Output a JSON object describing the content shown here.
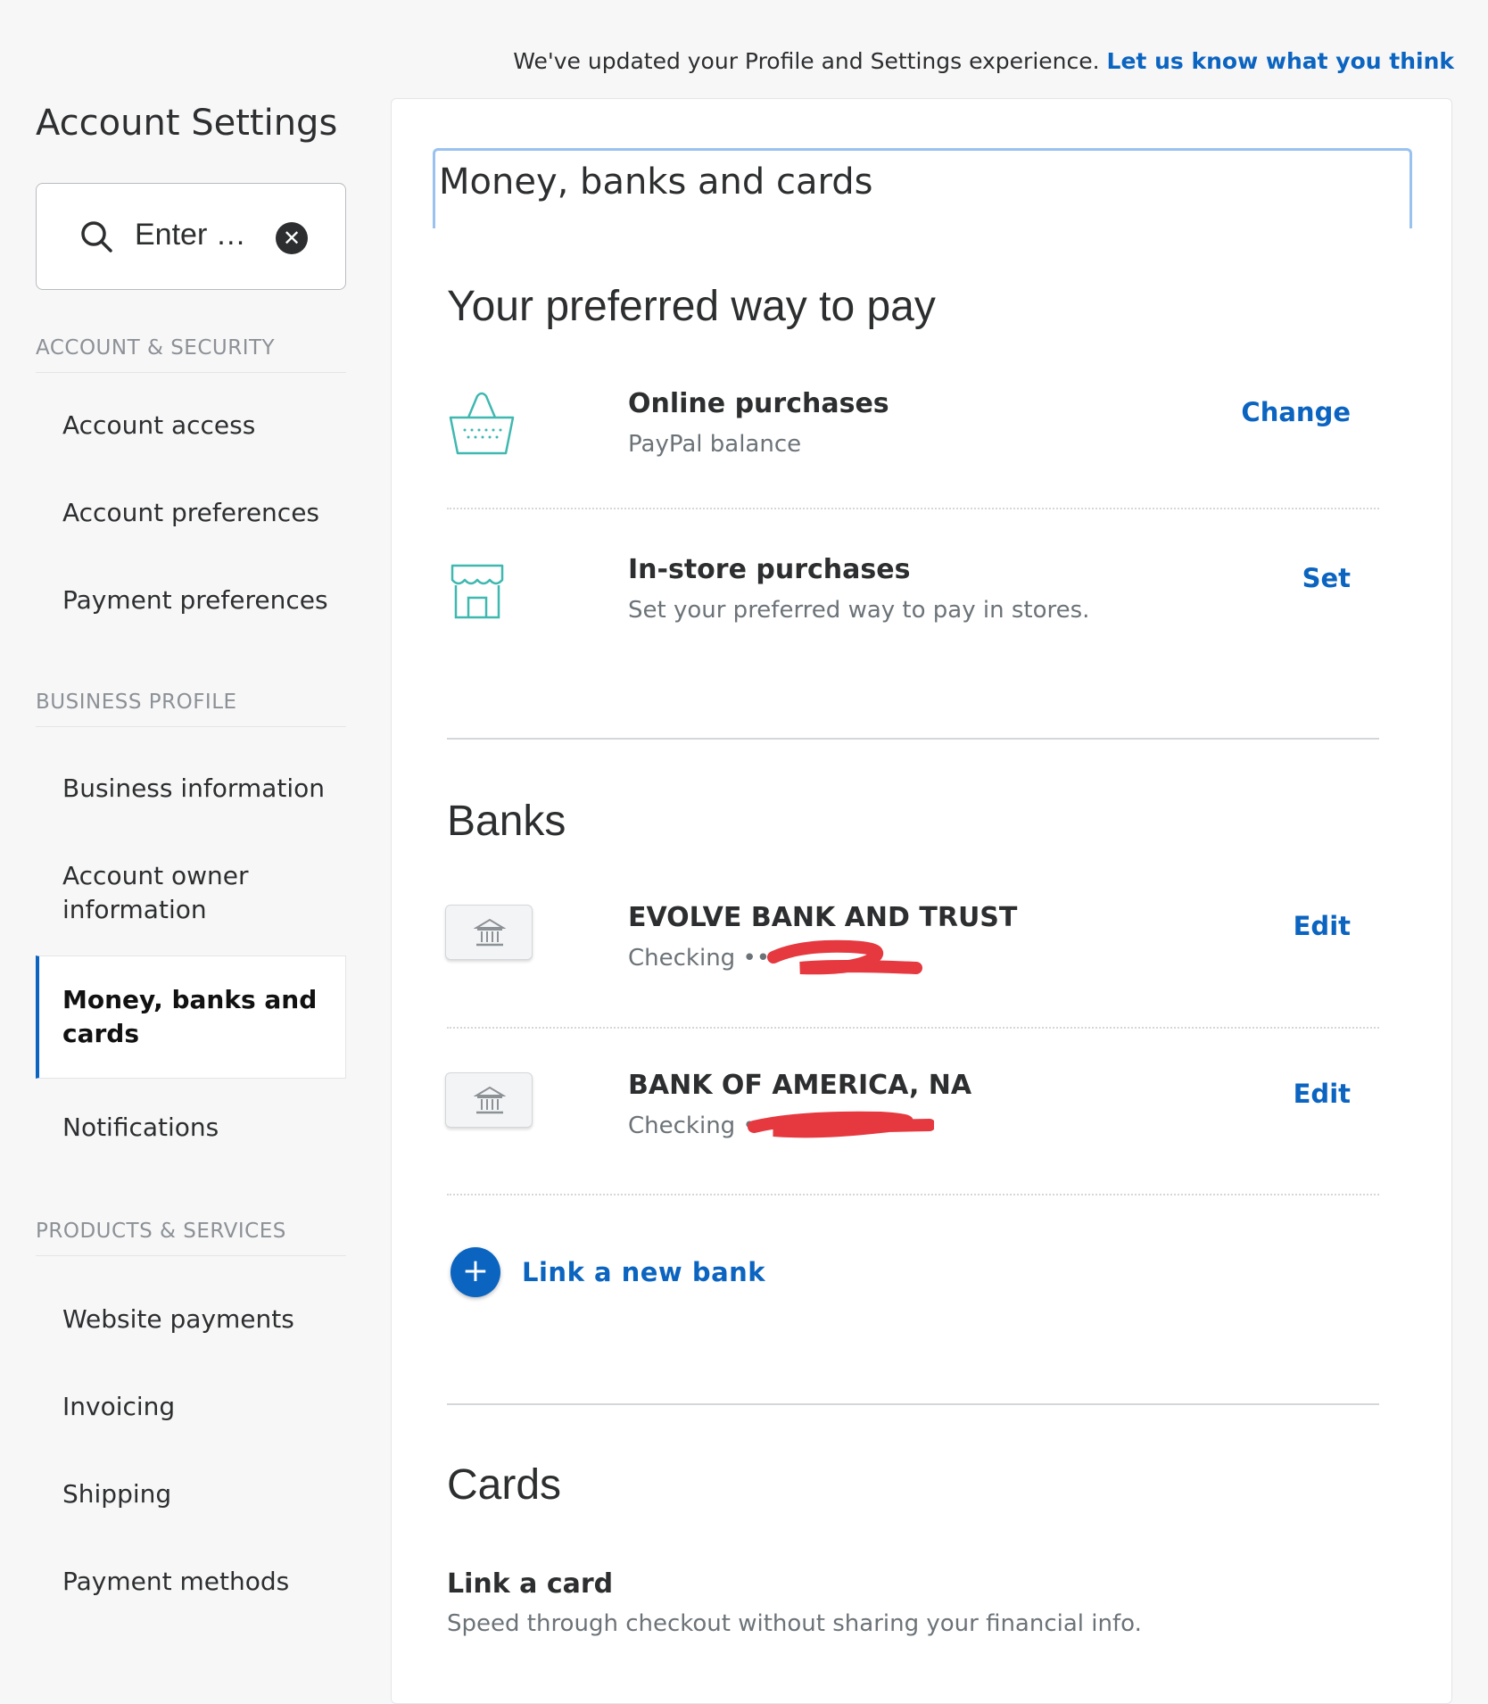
{
  "banner": {
    "text": "We've updated your Profile and Settings experience.",
    "link": "Let us know what you think"
  },
  "sidebar": {
    "title": "Account Settings",
    "search_placeholder": "Enter …",
    "sections": [
      {
        "label": "ACCOUNT & SECURITY",
        "items": [
          "Account access",
          "Account preferences",
          "Payment preferences"
        ]
      },
      {
        "label": "BUSINESS PROFILE",
        "items": [
          "Business information",
          "Account owner information",
          "Money, banks and cards",
          "Notifications"
        ]
      },
      {
        "label": "PRODUCTS & SERVICES",
        "items": [
          "Website payments",
          "Invoicing",
          "Shipping",
          "Payment methods"
        ]
      }
    ],
    "active_item": "Money, banks and cards"
  },
  "main": {
    "heading": "Money, banks and cards",
    "preferred": {
      "title": "Your preferred way to pay",
      "online": {
        "title": "Online purchases",
        "sub": "PayPal balance",
        "action": "Change"
      },
      "instore": {
        "title": "In-store purchases",
        "sub": "Set your preferred way to pay in stores.",
        "action": "Set"
      }
    },
    "banks": {
      "title": "Banks",
      "list": [
        {
          "name": "EVOLVE BANK AND TRUST",
          "sub": "Checking ••",
          "action": "Edit"
        },
        {
          "name": "BANK OF AMERICA, NA",
          "sub": "Checking •",
          "action": "Edit"
        }
      ],
      "link_new": "Link a new bank"
    },
    "cards": {
      "title": "Cards",
      "link_title": "Link a card",
      "link_sub": "Speed through checkout without sharing your financial info."
    }
  },
  "colors": {
    "accent": "#0b64c0",
    "redaction": "#e5383f",
    "focus": "#99c2f0"
  }
}
